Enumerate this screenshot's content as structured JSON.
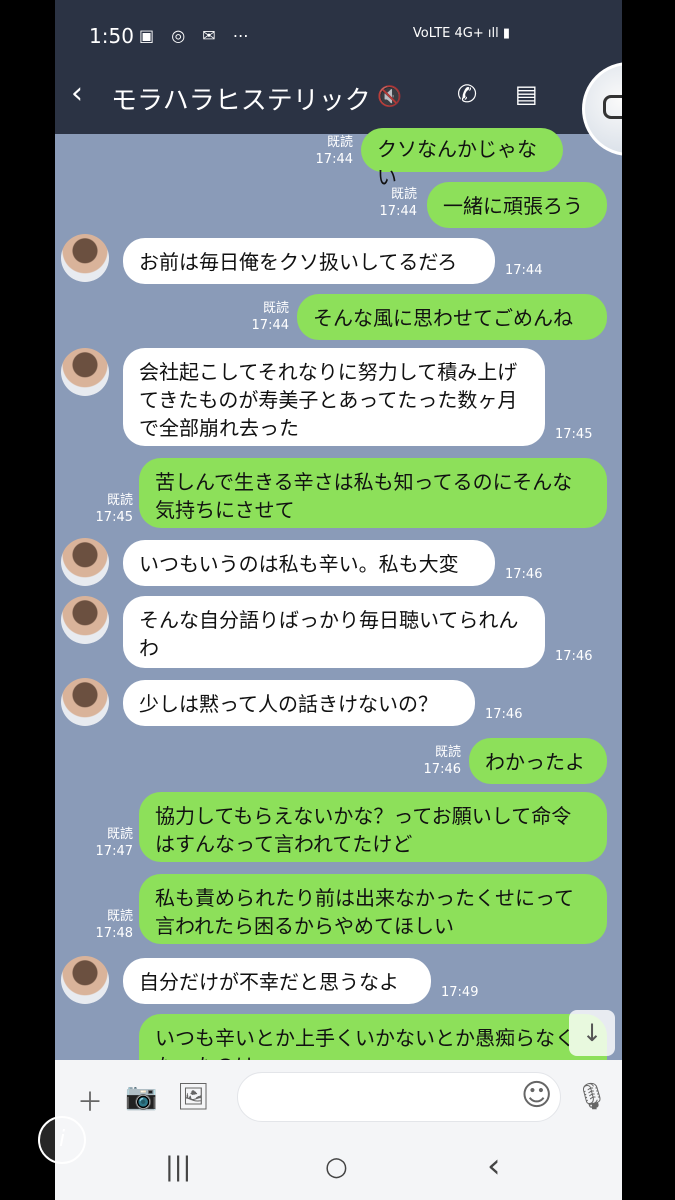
{
  "status": {
    "time": "1:50",
    "icons": "▣ ◎ ✉ ⋯",
    "right": "VoLTE 4G+ ıll ▮"
  },
  "header": {
    "back": "‹",
    "title": "モラハラヒステリック",
    "mute": "🔇",
    "call": "✆",
    "menu": "▤"
  },
  "messages": [
    {
      "dir": "out",
      "read": "既読",
      "time": "17:44",
      "text": "クソなんかじゃない"
    },
    {
      "dir": "out",
      "read": "既読",
      "time": "17:44",
      "text": "一緒に頑張ろう"
    },
    {
      "dir": "in",
      "time": "17:44",
      "text": "お前は毎日俺をクソ扱いしてるだろ"
    },
    {
      "dir": "out",
      "read": "既読",
      "time": "17:44",
      "text": "そんな風に思わせてごめんね"
    },
    {
      "dir": "in",
      "time": "17:45",
      "text": "会社起こしてそれなりに努力して積み上げてきたものが寿美子とあってたった数ヶ月で全部崩れ去った"
    },
    {
      "dir": "out",
      "read": "既読",
      "time": "17:45",
      "text": "苦しんで生きる辛さは私も知ってるのにそんな気持ちにさせて"
    },
    {
      "dir": "in",
      "time": "17:46",
      "text": "いつもいうのは私も辛い。私も大変"
    },
    {
      "dir": "in",
      "time": "17:46",
      "text": "そんな自分語りばっかり毎日聴いてられんわ"
    },
    {
      "dir": "in",
      "time": "17:46",
      "text": "少しは黙って人の話きけないの？"
    },
    {
      "dir": "out",
      "read": "既読",
      "time": "17:46",
      "text": "わかったよ"
    },
    {
      "dir": "out",
      "read": "既読",
      "time": "17:47",
      "text": "協力してもらえないかな？ってお願いして命令はすんなって言われてたけど"
    },
    {
      "dir": "out",
      "read": "既読",
      "time": "17:48",
      "text": "私も責められたり前は出来なかったくせにって言われたら困るからやめてほしい"
    },
    {
      "dir": "in",
      "time": "17:49",
      "text": "自分だけが不幸だと思うなよ"
    },
    {
      "dir": "out",
      "read": "",
      "time": "",
      "text": "いつも辛いとか上手くいかないとか愚痴らなくなったのは"
    }
  ],
  "input": {
    "plus": "＋",
    "camera": "📷",
    "image": "🖼",
    "emoji": "☺",
    "mic": "🎙",
    "placeholder": ""
  },
  "nav": {
    "recent": "|||",
    "home": "○",
    "back": "‹"
  },
  "scroll_down": "↓",
  "info": "i"
}
